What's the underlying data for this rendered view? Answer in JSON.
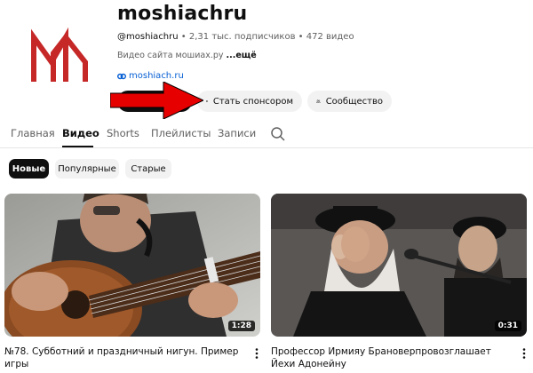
{
  "channel": {
    "name": "moshiachru",
    "handle": "@moshiachru",
    "subscribers": "2,31 тыс. подписчиков",
    "videos_count": "472 видео",
    "separator": " • ",
    "description": "Видео сайта мошиах.ру",
    "more_label": "...ещё",
    "link": "moshiach.ru",
    "brand_color": "#c62828"
  },
  "buttons": {
    "sponsor_label": "Стать спонсором",
    "community_label": "Сообщество"
  },
  "tabs": [
    {
      "label": "Главная",
      "active": false
    },
    {
      "label": "Видео",
      "active": true
    },
    {
      "label": "Shorts",
      "active": false
    },
    {
      "label": "Плейлисты",
      "active": false
    },
    {
      "label": "Записи",
      "active": false
    }
  ],
  "filters": [
    {
      "label": "Новые",
      "active": true
    },
    {
      "label": "Популярные",
      "active": false
    },
    {
      "label": "Старые",
      "active": false
    }
  ],
  "videos": [
    {
      "title": "№78. Субботний и праздничный нигун. Пример игры",
      "duration": "1:28"
    },
    {
      "title": "Профессор Ирмияу Брановерпровозглашает Йехи Адонейну",
      "duration": "0:31"
    }
  ],
  "annotation": {
    "arrow_color": "#e60000"
  },
  "icons": {
    "sponsor": "star-circle-icon",
    "community": "people-icon",
    "link": "link-icon",
    "search": "search-icon",
    "menu": "more-vertical-icon"
  }
}
